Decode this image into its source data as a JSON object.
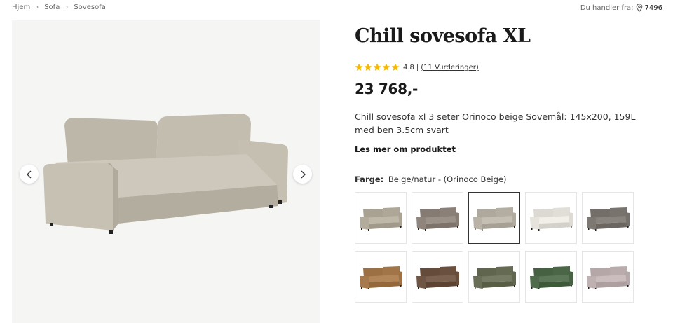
{
  "breadcrumb": [
    {
      "label": "Hjem"
    },
    {
      "label": "Sofa"
    },
    {
      "label": "Sovesofa"
    }
  ],
  "store": {
    "prefix": "Du handler fra:",
    "zip": "7496",
    "icon": "location-pin-icon"
  },
  "gallery": {
    "prev_icon": "chevron-left-icon",
    "next_icon": "chevron-right-icon",
    "image": "sofa-photo"
  },
  "product": {
    "title": "Chill sovesofa XL",
    "rating_value": "4.8",
    "rating_separator": "|",
    "reviews_text": "(11 Vurderinger)",
    "stars": 5,
    "star_color": "#f5b800",
    "price": "23 768,-",
    "description": "Chill sovesofa xl 3 seter Orinoco beige Sovemål: 145x200, 159L med ben 3.5cm svart",
    "more_link": "Les mer om produktet",
    "color_label": "Farge:",
    "color_value": "Beige/natur - (Orinoco Beige)"
  },
  "swatches": [
    {
      "name": "swatch-beige-light",
      "color": "#b3ab9c",
      "selected": false
    },
    {
      "name": "swatch-taupe",
      "color": "#8f857d",
      "selected": false
    },
    {
      "name": "swatch-orinoco-beige",
      "color": "#b8b3a6",
      "selected": true
    },
    {
      "name": "swatch-off-white",
      "color": "#e6e3dc",
      "selected": false
    },
    {
      "name": "swatch-grey-brown",
      "color": "#7e7873",
      "selected": false
    },
    {
      "name": "swatch-cognac",
      "color": "#a67a4c",
      "selected": false
    },
    {
      "name": "swatch-brown",
      "color": "#6e5544",
      "selected": false
    },
    {
      "name": "swatch-olive",
      "color": "#6a6f57",
      "selected": false
    },
    {
      "name": "swatch-green",
      "color": "#4f6b4c",
      "selected": false
    },
    {
      "name": "swatch-lilac-grey",
      "color": "#bfb1b1",
      "selected": false
    }
  ]
}
